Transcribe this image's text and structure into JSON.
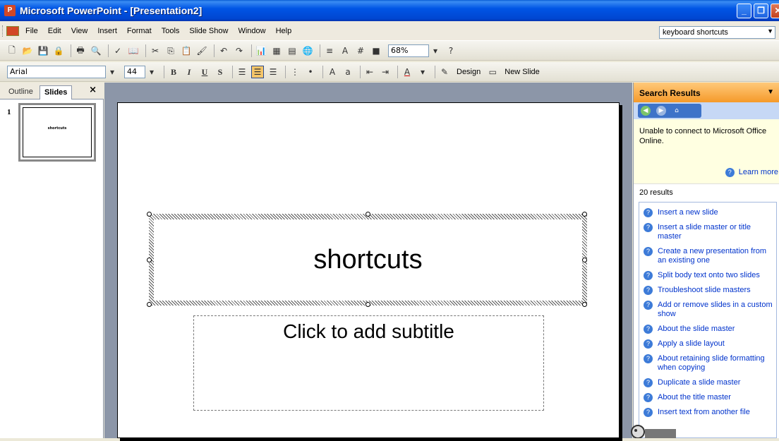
{
  "window": {
    "title": "Microsoft PowerPoint - [Presentation2]"
  },
  "menu": {
    "items": [
      "File",
      "Edit",
      "View",
      "Insert",
      "Format",
      "Tools",
      "Slide Show",
      "Window",
      "Help"
    ],
    "ask_question": "keyboard shortcuts"
  },
  "standard_toolbar": {
    "zoom": "68%"
  },
  "formatting_toolbar": {
    "font": "Arial",
    "size": "44",
    "bold": "B",
    "italic": "I",
    "underline": "U",
    "shadow": "S",
    "design_label": "Design",
    "new_slide_label": "New Slide"
  },
  "outline_pane": {
    "tab_outline": "Outline",
    "tab_slides": "Slides",
    "close": "×",
    "slide_number": "1",
    "thumb_text": "shortcuts"
  },
  "slide": {
    "title": "shortcuts",
    "subtitle_placeholder": "Click to add subtitle"
  },
  "task_pane": {
    "header": "Search Results",
    "message": "Unable to connect to Microsoft Office Online.",
    "learn_more": "Learn more",
    "result_count": "20 results",
    "results": [
      "Insert a new slide",
      "Insert a slide master or title master",
      "Create a new presentation from an existing one",
      "Split body text onto two slides",
      "Troubleshoot slide masters",
      "Add or remove slides in a custom show",
      "About the slide master",
      "Apply a slide layout",
      "About retaining slide formatting when copying",
      "Duplicate a slide master",
      "About the title master",
      "Insert text from another file"
    ]
  }
}
